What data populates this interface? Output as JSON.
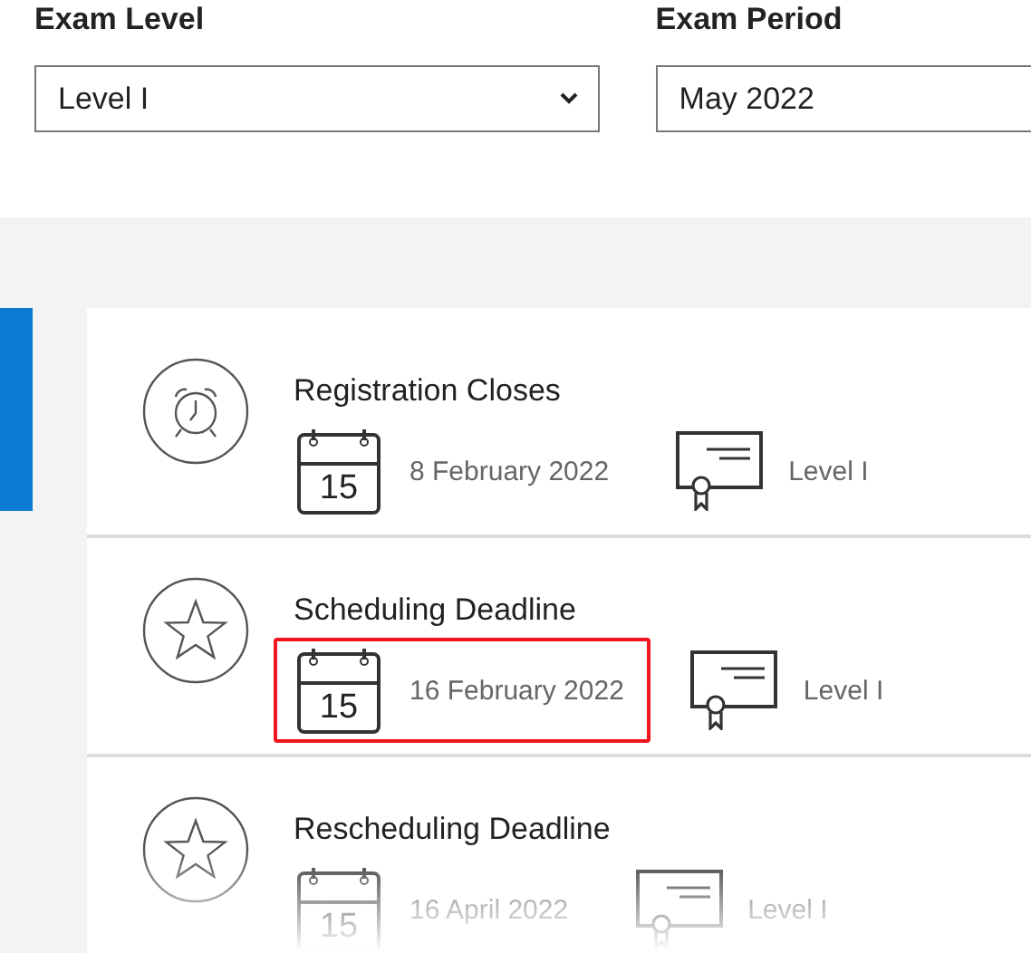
{
  "filters": [
    {
      "label": "Exam Level",
      "value": "Level I",
      "kind": "dropdown"
    },
    {
      "label": "Exam Period",
      "value": "May 2022",
      "kind": "text"
    }
  ],
  "events": [
    {
      "kind": "alarm",
      "title": "Registration Closes",
      "calendar_day": "15",
      "date": "8 February 2022",
      "level": "Level I",
      "highlighted": false
    },
    {
      "kind": "star",
      "title": "Scheduling Deadline",
      "calendar_day": "15",
      "date": "16 February 2022",
      "level": "Level I",
      "highlighted": true
    },
    {
      "kind": "star",
      "title": "Rescheduling Deadline",
      "calendar_day": "15",
      "date": "16 April 2022",
      "level": "Level I",
      "highlighted": false
    }
  ]
}
